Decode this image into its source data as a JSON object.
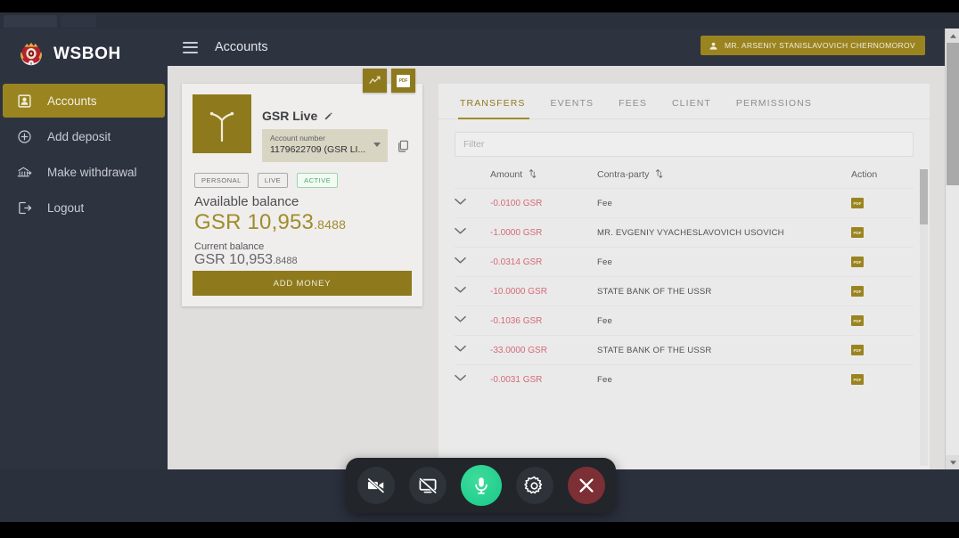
{
  "brand": {
    "name": "WSBOH",
    "crest_icon": "coat-of-arms-crest-icon"
  },
  "sidebar": {
    "items": [
      {
        "label": "Accounts",
        "icon": "id-badge-icon",
        "active": true
      },
      {
        "label": "Add deposit",
        "icon": "plus-circle-icon",
        "active": false
      },
      {
        "label": "Make withdrawal",
        "icon": "bank-withdraw-icon",
        "active": false
      },
      {
        "label": "Logout",
        "icon": "logout-arrow-icon",
        "active": false
      }
    ]
  },
  "topbar": {
    "menu_icon": "hamburger-menu-icon",
    "title": "Accounts",
    "user": {
      "name": "MR. ARSENIY STANISLAVOVICH CHERNOMOROV",
      "icon": "user-avatar-icon"
    }
  },
  "account_card": {
    "logo_icon": "tree-rune-logo-icon",
    "actions": [
      {
        "name": "chart-button",
        "icon": "trend-chart-icon"
      },
      {
        "name": "pdf-button",
        "icon": "pdf-document-icon",
        "glyph": "PDF"
      }
    ],
    "title": "GSR Live",
    "edit_icon": "pencil-edit-icon",
    "account_select": {
      "label": "Account number",
      "value": "1179622709 (GSR LI...",
      "caret_icon": "chevron-down-icon"
    },
    "copy_icon": "copy-icon",
    "badges": [
      {
        "text": "PERSONAL",
        "style": "grey"
      },
      {
        "text": "LIVE",
        "style": "grey"
      },
      {
        "text": "ACTIVE",
        "style": "green"
      }
    ],
    "available_label": "Available balance",
    "available_int": "GSR 10,953",
    "available_frac": ".8488",
    "current_label": "Current balance",
    "current_int": "GSR 10,953",
    "current_frac": ".8488",
    "add_money_label": "ADD MONEY"
  },
  "details": {
    "tabs": [
      {
        "label": "TRANSFERS",
        "active": true
      },
      {
        "label": "EVENTS",
        "active": false
      },
      {
        "label": "FEES",
        "active": false
      },
      {
        "label": "CLIENT",
        "active": false
      },
      {
        "label": "PERMISSIONS",
        "active": false
      }
    ],
    "filter_placeholder": "Filter",
    "filter_value": "",
    "columns": {
      "expand": "",
      "amount": "Amount",
      "contra_party": "Contra-party",
      "action": "Action"
    },
    "sort_icon": "sort-arrows-icon",
    "expand_icon": "chevron-down-icon",
    "row_action_icon": "pdf-document-icon",
    "row_action_glyph": "PDF",
    "rows": [
      {
        "amount": "-0.0100 GSR",
        "contra_party": "Fee"
      },
      {
        "amount": "-1.0000 GSR",
        "contra_party": "MR. EVGENIY VYACHESLAVOVICH USOVICH"
      },
      {
        "amount": "-0.0314 GSR",
        "contra_party": "Fee"
      },
      {
        "amount": "-10.0000 GSR",
        "contra_party": "STATE BANK OF THE USSR"
      },
      {
        "amount": "-0.1036 GSR",
        "contra_party": "Fee"
      },
      {
        "amount": "-33.0000 GSR",
        "contra_party": "STATE BANK OF THE USSR"
      },
      {
        "amount": "-0.0031 GSR",
        "contra_party": "Fee"
      }
    ]
  },
  "call_bar": {
    "buttons": [
      {
        "name": "camera-off-button",
        "icon": "video-camera-off-icon",
        "state": "off"
      },
      {
        "name": "screen-share-off-button",
        "icon": "screen-share-off-icon",
        "state": "off"
      },
      {
        "name": "microphone-button",
        "icon": "microphone-icon",
        "state": "active"
      },
      {
        "name": "settings-button",
        "icon": "gear-icon",
        "state": "idle"
      },
      {
        "name": "end-call-button",
        "icon": "close-x-icon",
        "state": "danger"
      }
    ]
  },
  "colors": {
    "accent_gold": "#9a8420",
    "sidebar_dark": "#2e3340",
    "balance_gold": "#a08c2a",
    "amount_negative": "#d36a77",
    "badge_green": "#51a866",
    "mic_active_green": "#17c98a",
    "end_call_red": "#7d2f36"
  }
}
